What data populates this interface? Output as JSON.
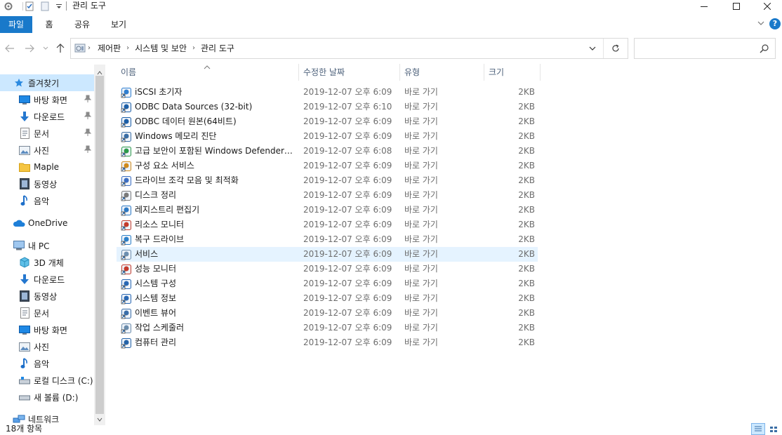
{
  "window": {
    "title": "관리 도구"
  },
  "ribbon": {
    "tabs": [
      "파일",
      "홈",
      "공유",
      "보기"
    ]
  },
  "address": {
    "crumbs": [
      "제어판",
      "시스템 및 보안",
      "관리 도구"
    ]
  },
  "search": {
    "placeholder": ""
  },
  "nav": {
    "quick_access": "즐겨찾기",
    "quick_items": [
      "바탕 화면",
      "다운로드",
      "문서",
      "사진",
      "Maple",
      "동영상",
      "음악"
    ],
    "onedrive": "OneDrive",
    "this_pc": "내 PC",
    "pc_items": [
      "3D 개체",
      "다운로드",
      "동영상",
      "문서",
      "바탕 화면",
      "사진",
      "음악",
      "로컬 디스크 (C:)",
      "새 볼륨 (D:)"
    ],
    "network": "네트워크"
  },
  "columns": {
    "name": "이름",
    "date": "수정한 날짜",
    "type": "유형",
    "size": "크기"
  },
  "files": [
    {
      "name": "iSCSI 초기자",
      "date": "2019-12-07 오후 6:09",
      "type": "바로 가기",
      "size": "2KB"
    },
    {
      "name": "ODBC Data Sources (32-bit)",
      "date": "2019-12-07 오후 6:10",
      "type": "바로 가기",
      "size": "2KB"
    },
    {
      "name": "ODBC 데이터 원본(64비트)",
      "date": "2019-12-07 오후 6:09",
      "type": "바로 가기",
      "size": "2KB"
    },
    {
      "name": "Windows 메모리 진단",
      "date": "2019-12-07 오후 6:09",
      "type": "바로 가기",
      "size": "2KB"
    },
    {
      "name": "고급 보안이 포함된 Windows Defender ...",
      "date": "2019-12-07 오후 6:08",
      "type": "바로 가기",
      "size": "2KB"
    },
    {
      "name": "구성 요소 서비스",
      "date": "2019-12-07 오후 6:09",
      "type": "바로 가기",
      "size": "2KB"
    },
    {
      "name": "드라이브 조각 모음 및 최적화",
      "date": "2019-12-07 오후 6:09",
      "type": "바로 가기",
      "size": "2KB"
    },
    {
      "name": "디스크 정리",
      "date": "2019-12-07 오후 6:09",
      "type": "바로 가기",
      "size": "2KB"
    },
    {
      "name": "레지스트리 편집기",
      "date": "2019-12-07 오후 6:09",
      "type": "바로 가기",
      "size": "2KB"
    },
    {
      "name": "리소스 모니터",
      "date": "2019-12-07 오후 6:09",
      "type": "바로 가기",
      "size": "2KB"
    },
    {
      "name": "복구 드라이브",
      "date": "2019-12-07 오후 6:09",
      "type": "바로 가기",
      "size": "2KB"
    },
    {
      "name": "서비스",
      "date": "2019-12-07 오후 6:09",
      "type": "바로 가기",
      "size": "2KB"
    },
    {
      "name": "성능 모니터",
      "date": "2019-12-07 오후 6:09",
      "type": "바로 가기",
      "size": "2KB"
    },
    {
      "name": "시스템 구성",
      "date": "2019-12-07 오후 6:09",
      "type": "바로 가기",
      "size": "2KB"
    },
    {
      "name": "시스템 정보",
      "date": "2019-12-07 오후 6:09",
      "type": "바로 가기",
      "size": "2KB"
    },
    {
      "name": "이벤트 뷰어",
      "date": "2019-12-07 오후 6:09",
      "type": "바로 가기",
      "size": "2KB"
    },
    {
      "name": "작업 스케줄러",
      "date": "2019-12-07 오후 6:09",
      "type": "바로 가기",
      "size": "2KB"
    },
    {
      "name": "컴퓨터 관리",
      "date": "2019-12-07 오후 6:09",
      "type": "바로 가기",
      "size": "2KB"
    }
  ],
  "status": {
    "count": "18개 항목"
  },
  "colors": {
    "accent": "#1979ca",
    "selection": "#e5f3ff",
    "header_text": "#4c607a"
  }
}
